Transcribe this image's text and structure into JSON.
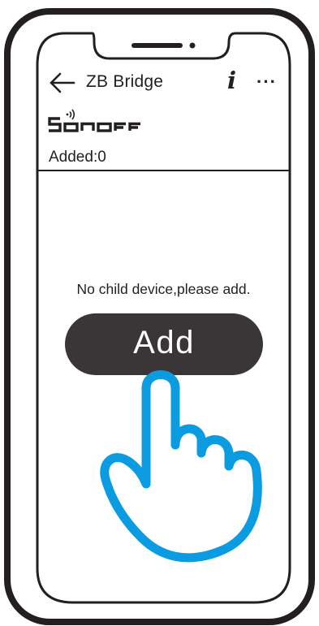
{
  "header": {
    "title": "ZB Bridge",
    "info_icon": "i",
    "more_icon": "···"
  },
  "brand": {
    "logo_text": "SONOFF"
  },
  "status": {
    "added_text": "Added:0"
  },
  "main": {
    "empty_message": "No child device,please add.",
    "add_label": "Add"
  },
  "colors": {
    "outline": "#231f20",
    "button_bg": "#3a3536",
    "hand_accent": "#0b9be0"
  },
  "icons": {
    "back": "back-arrow-icon",
    "info": "info-icon",
    "more": "more-icon",
    "wireless": "wireless-signal-icon",
    "hand": "tap-hand-icon"
  }
}
